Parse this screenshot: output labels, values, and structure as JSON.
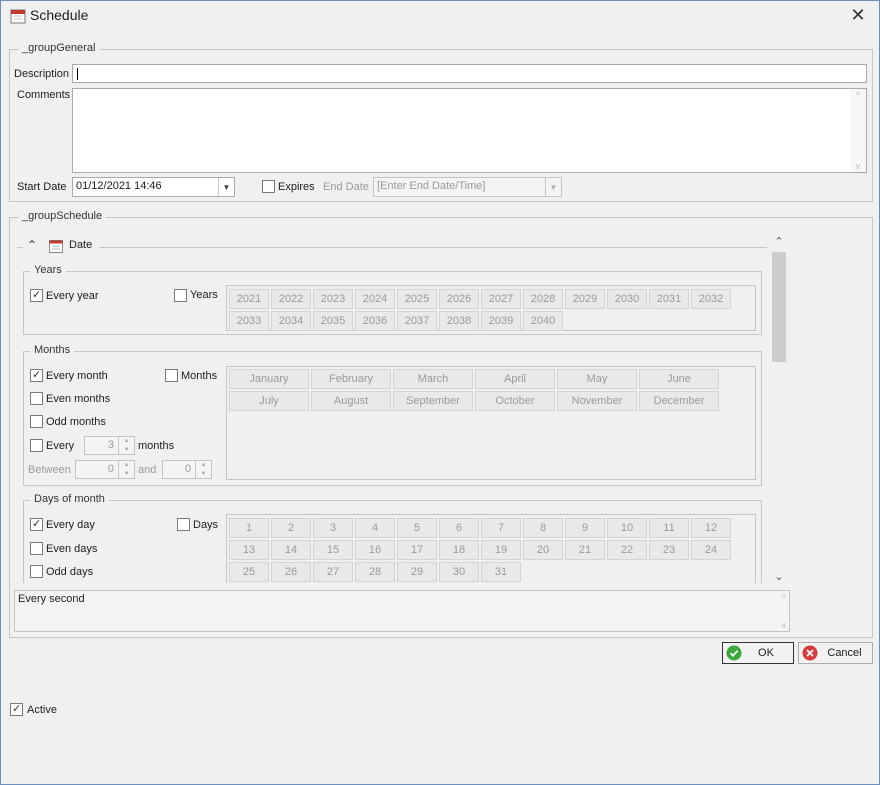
{
  "window": {
    "title": "Schedule"
  },
  "group_general": {
    "legend": "_groupGeneral",
    "description_label": "Description",
    "description_value": "",
    "comments_label": "Comments",
    "comments_value": "",
    "start_date_label": "Start Date",
    "start_date_value": "01/12/2021 14:46",
    "expires_label": "Expires",
    "expires_checked": false,
    "end_date_label": "End Date",
    "end_date_placeholder": "[Enter End  Date/Time]"
  },
  "group_schedule": {
    "legend": "_groupSchedule",
    "date_section_label": "Date",
    "years": {
      "legend": "Years",
      "every_year_label": "Every year",
      "every_year_checked": true,
      "years_label": "Years",
      "years_checked": false,
      "values": [
        "2021",
        "2022",
        "2023",
        "2024",
        "2025",
        "2026",
        "2027",
        "2028",
        "2029",
        "2030",
        "2031",
        "2032",
        "2033",
        "2034",
        "2035",
        "2036",
        "2037",
        "2038",
        "2039",
        "2040"
      ]
    },
    "months": {
      "legend": "Months",
      "every_month_label": "Every month",
      "every_month_checked": true,
      "months_label": "Months",
      "months_checked": false,
      "even_months_label": "Even months",
      "odd_months_label": "Odd months",
      "every_label": "Every",
      "every_value": "3",
      "every_suffix": "months",
      "between_label": "Between",
      "between_from": "0",
      "and_label": "and",
      "between_to": "0",
      "values": [
        "January",
        "February",
        "March",
        "April",
        "May",
        "June",
        "July",
        "August",
        "September",
        "October",
        "November",
        "December"
      ]
    },
    "days": {
      "legend": "Days of month",
      "every_day_label": "Every day",
      "every_day_checked": true,
      "days_label": "Days",
      "days_checked": false,
      "even_days_label": "Even days",
      "odd_days_label": "Odd days",
      "values": [
        "1",
        "2",
        "3",
        "4",
        "5",
        "6",
        "7",
        "8",
        "9",
        "10",
        "11",
        "12",
        "13",
        "14",
        "15",
        "16",
        "17",
        "18",
        "19",
        "20",
        "21",
        "22",
        "23",
        "24",
        "25",
        "26",
        "27",
        "28",
        "29",
        "30",
        "31"
      ]
    },
    "summary_text": "Every second"
  },
  "buttons": {
    "ok_label": "OK",
    "cancel_label": "Cancel"
  },
  "active": {
    "label": "Active",
    "checked": true
  },
  "colors": {
    "ok_icon": "#3aa83a",
    "cancel_icon": "#d93a3a",
    "calendar_icon": "#c0392b"
  }
}
